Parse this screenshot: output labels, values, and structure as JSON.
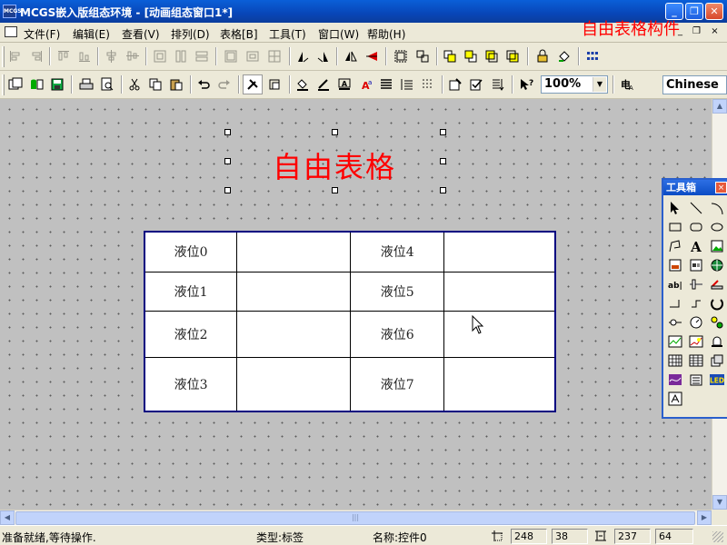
{
  "window": {
    "app_icon_text": "MCGS",
    "title": "MCGS嵌入版组态环境 - [动画组态窗口1*]",
    "min_symbol": "_",
    "max_symbol": "❐",
    "close_symbol": "✕"
  },
  "menu": {
    "items": [
      "文件(F)",
      "编辑(E)",
      "查看(V)",
      "排列(D)",
      "表格[B]",
      "工具(T)",
      "窗口(W)",
      "帮助(H)"
    ],
    "mdi_min": "_",
    "mdi_restore": "❐",
    "mdi_close": "×"
  },
  "annotation": "自由表格构件",
  "toolbar": {
    "zoom_value": "100%",
    "zoom_arrow": "▼",
    "language": "Chinese"
  },
  "canvas": {
    "label_text": "自由表格",
    "table_rows": [
      [
        "液位0",
        "",
        "液位4",
        ""
      ],
      [
        "液位1",
        "",
        "液位5",
        ""
      ],
      [
        "液位2",
        "",
        "液位6",
        ""
      ],
      [
        "液位3",
        "",
        "液位7",
        ""
      ]
    ]
  },
  "toolbox": {
    "title": "工具箱",
    "close_symbol": "×",
    "text_tool_label": "A",
    "input_tool_label": "ab|",
    "led_tool_label": "LED"
  },
  "scrollbars": {
    "up": "▲",
    "down": "▼",
    "left": "◀",
    "right": "▶",
    "thumb_grip": "|||"
  },
  "status": {
    "message": "准备就绪,等待操作.",
    "type_label": "类型:标签",
    "name_label": "名称:控件0",
    "pos_x": "248",
    "pos_y": "38",
    "width": "237",
    "height": "64"
  },
  "colors": {
    "title_bar": "#0846b8",
    "annotation_red": "#ff0000",
    "table_border": "#000080",
    "canvas_bg": "#c0c0c0"
  }
}
